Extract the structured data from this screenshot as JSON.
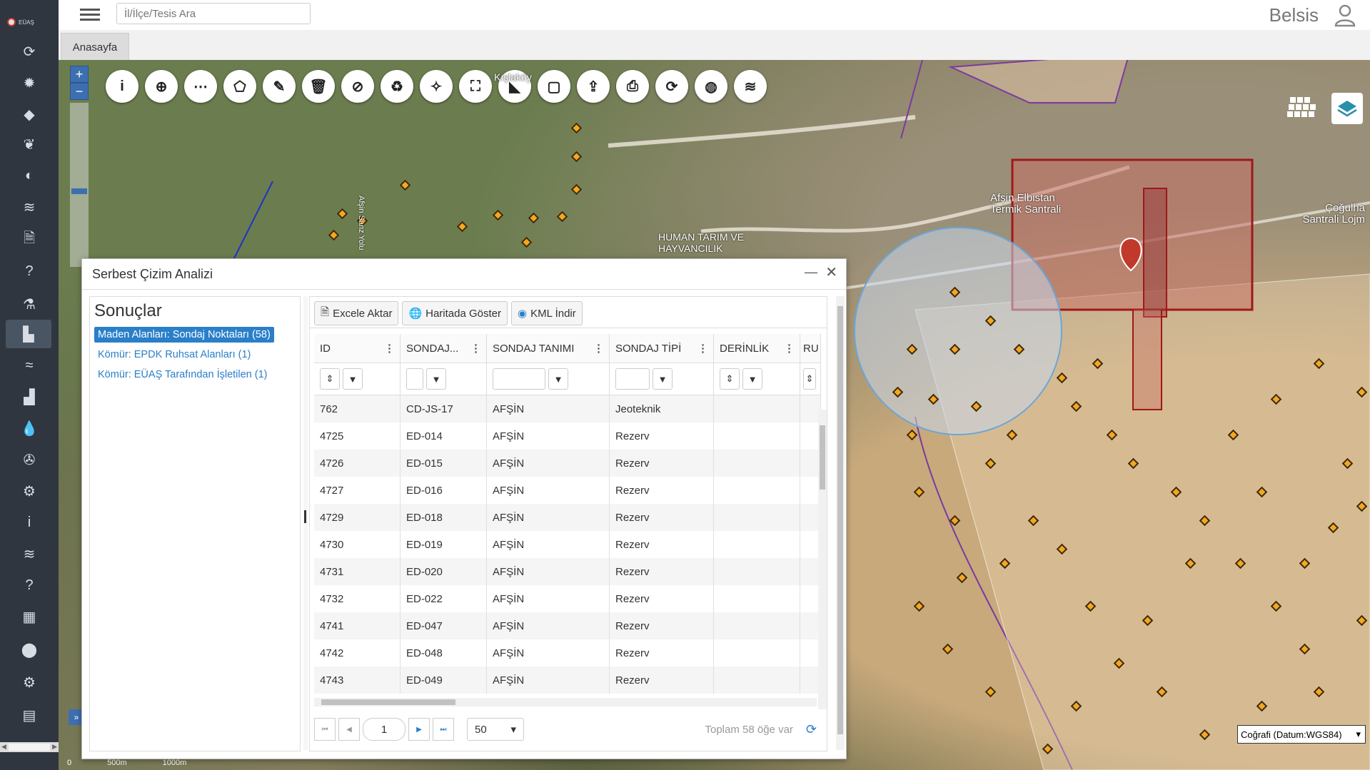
{
  "logo_text": "EÜAŞ",
  "search": {
    "placeholder": "İl/İlçe/Tesis Ara"
  },
  "brand": "Belsis",
  "tabs": [
    {
      "label": "Anasayfa"
    }
  ],
  "sidebar_icons": [
    "refresh-icon",
    "sun-icon",
    "gem-icon",
    "plant-icon",
    "fill-icon",
    "wind-icon",
    "document-icon",
    "help-icon",
    "flask-icon",
    "chart-area-icon",
    "waves-icon",
    "factory-icon",
    "drop-icon",
    "wind-turbine-icon",
    "cogs-icon",
    "info-icon",
    "water-icon",
    "help2-icon",
    "building-icon",
    "pin-icon",
    "settings-icon",
    "archive-icon"
  ],
  "map": {
    "labels": [
      "Afşin Elbistan Termik Santrali",
      "Çoğulha Santrali Lojm",
      "HUMAN TARIM VE HAYVANCILIK",
      "Afşin Sanz Yolu",
      "Kışlaköy"
    ],
    "coord_select": "Coğrafi (Datum:WGS84)",
    "scale": [
      "0",
      "500m",
      "1000m"
    ]
  },
  "dialog": {
    "title": "Serbest Çizim Analizi",
    "results_title": "Sonuçlar",
    "results": [
      {
        "label": "Maden Alanları: Sondaj Noktaları (58)",
        "active": true
      },
      {
        "label": "Kömür: EPDK Ruhsat Alanları (1)",
        "active": false
      },
      {
        "label": "Kömür: EÜAŞ Tarafından İşletilen (1)",
        "active": false
      }
    ],
    "toolbar": {
      "excel": "Excele Aktar",
      "map": "Haritada Göster",
      "kml": "KML İndir"
    },
    "columns": [
      "ID",
      "SONDAJ...",
      "SONDAJ TANIMI",
      "SONDAJ TİPİ",
      "DERİNLİK",
      "RU"
    ],
    "rows": [
      [
        "762",
        "CD-JS-17",
        "AFŞİN",
        "Jeoteknik",
        ""
      ],
      [
        "4725",
        "ED-014",
        "AFŞİN",
        "Rezerv",
        ""
      ],
      [
        "4726",
        "ED-015",
        "AFŞİN",
        "Rezerv",
        ""
      ],
      [
        "4727",
        "ED-016",
        "AFŞİN",
        "Rezerv",
        ""
      ],
      [
        "4729",
        "ED-018",
        "AFŞİN",
        "Rezerv",
        ""
      ],
      [
        "4730",
        "ED-019",
        "AFŞİN",
        "Rezerv",
        ""
      ],
      [
        "4731",
        "ED-020",
        "AFŞİN",
        "Rezerv",
        ""
      ],
      [
        "4732",
        "ED-022",
        "AFŞİN",
        "Rezerv",
        ""
      ],
      [
        "4741",
        "ED-047",
        "AFŞİN",
        "Rezerv",
        ""
      ],
      [
        "4742",
        "ED-048",
        "AFŞİN",
        "Rezerv",
        ""
      ],
      [
        "4743",
        "ED-049",
        "AFŞİN",
        "Rezerv",
        ""
      ]
    ],
    "pager": {
      "page": "1",
      "page_size": "50",
      "total": "Toplam 58 öğe var"
    }
  }
}
